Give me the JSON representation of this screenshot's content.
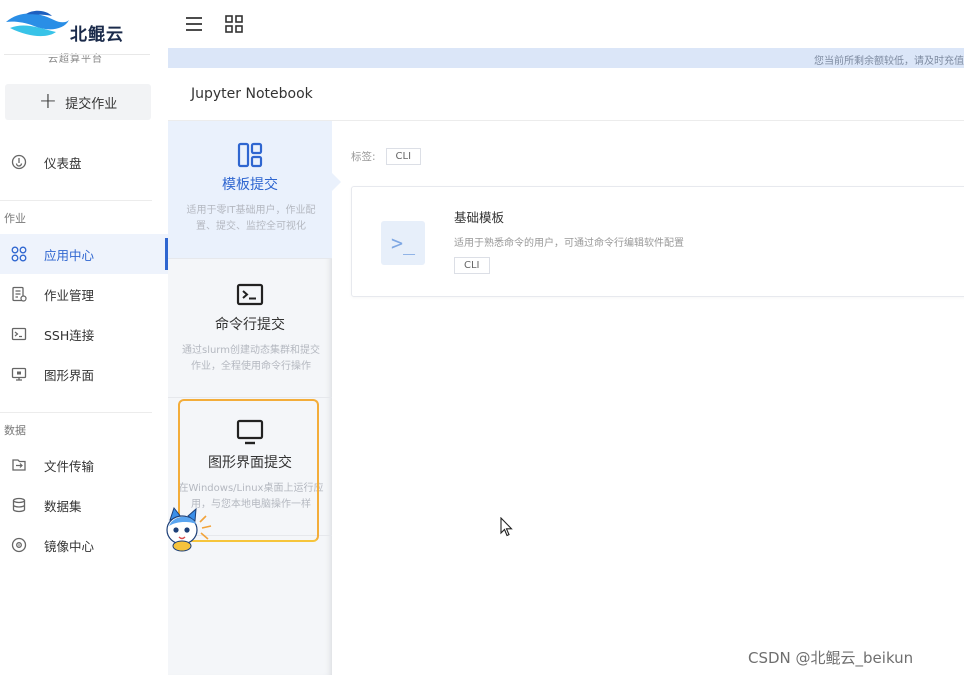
{
  "brand": {
    "name": "北鲲云",
    "subtitle": "云超算平台"
  },
  "sidebar": {
    "submit_label": "提交作业",
    "items_top": [
      {
        "label": "仪表盘",
        "icon": "dashboard-icon"
      }
    ],
    "section_job": "作业",
    "items_job": [
      {
        "label": "应用中心",
        "icon": "apps-icon",
        "active": true
      },
      {
        "label": "作业管理",
        "icon": "job-list-icon"
      },
      {
        "label": "SSH连接",
        "icon": "terminal-icon"
      },
      {
        "label": "图形界面",
        "icon": "desktop-icon"
      }
    ],
    "section_data": "数据",
    "items_data": [
      {
        "label": "文件传输",
        "icon": "file-transfer-icon"
      },
      {
        "label": "数据集",
        "icon": "database-icon"
      },
      {
        "label": "镜像中心",
        "icon": "image-disc-icon"
      }
    ]
  },
  "topbar": {
    "notice": "您当前所剩余额较低，请及时充值"
  },
  "page": {
    "title": "Jupyter Notebook"
  },
  "modes": [
    {
      "title": "模板提交",
      "desc": "适用于零IT基础用户，作业配置、提交、监控全可视化",
      "selected": true
    },
    {
      "title": "命令行提交",
      "desc": "通过slurm创建动态集群和提交 作业，全程使用命令行操作"
    },
    {
      "title": "图形界面提交",
      "desc": "在Windows/Linux桌面上运行应用，与您本地电脑操作一样"
    }
  ],
  "content": {
    "tags_label": "标签:",
    "tags": [
      "CLI"
    ],
    "template": {
      "name": "基础模板",
      "desc": "适用于熟悉命令的用户，可通过命令行编辑软件配置",
      "tag": "CLI",
      "thumb_glyph": ">_"
    }
  },
  "watermark": "CSDN @北鲲云_beikun",
  "colors": {
    "accent": "#2f66d0",
    "highlight": "#f3ad3a",
    "notice_bg": "#dbe6f8"
  }
}
